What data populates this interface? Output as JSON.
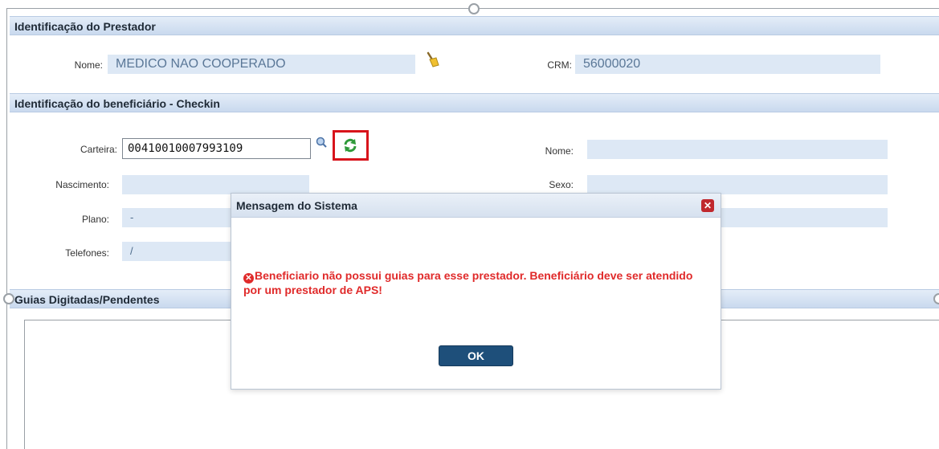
{
  "prestador": {
    "section_title": "Identificação do Prestador",
    "nome_label": "Nome:",
    "nome_value": "MEDICO NAO COOPERADO",
    "crm_label": "CRM:",
    "crm_value": "56000020"
  },
  "beneficiario": {
    "section_title": "Identificação do beneficiário - Checkin",
    "carteira_label": "Carteira:",
    "carteira_value": "00410010007993109",
    "nome_label": "Nome:",
    "nascimento_label": "Nascimento:",
    "sexo_label": "Sexo:",
    "plano_label": "Plano:",
    "plano_value": "-",
    "telefones_label": "Telefones:",
    "telefones_value": "/"
  },
  "guias": {
    "section_title": "Guias Digitadas/Pendentes"
  },
  "dialog": {
    "title": "Mensagem do Sistema",
    "close_glyph": "✕",
    "message": "Beneficiario não possui guias para esse prestador. Beneficiário deve ser atendido por um prestador de APS!",
    "error_glyph": "✕",
    "ok_label": "OK"
  },
  "colors": {
    "section_bar": "#c9d9ee",
    "field_bg": "#dde8f5",
    "error_text": "#e02a2a",
    "ok_button": "#1e4f7a",
    "highlight_box": "#d8141b"
  }
}
